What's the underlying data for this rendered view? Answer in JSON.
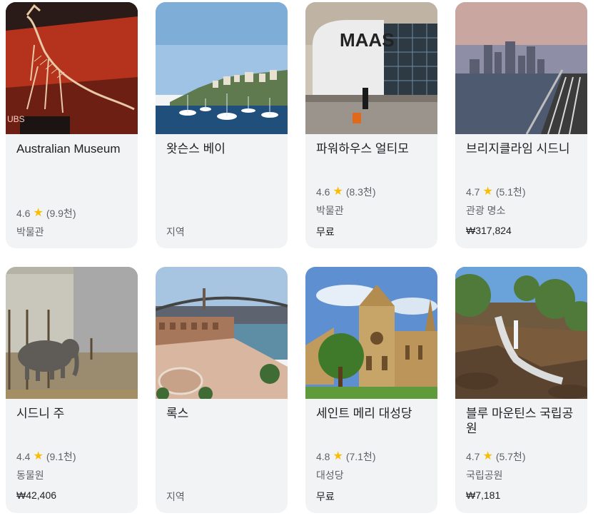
{
  "cards": [
    {
      "title": "Australian Museum",
      "rating": "4.6",
      "reviews": "(9.9천)",
      "category": "박물관",
      "price": ""
    },
    {
      "title": "왓슨스 베이",
      "rating": "",
      "reviews": "",
      "category": "지역",
      "price": ""
    },
    {
      "title": "파워하우스 얼티모",
      "rating": "4.6",
      "reviews": "(8.3천)",
      "category": "박물관",
      "price": "무료"
    },
    {
      "title": "브리지클라임 시드니",
      "rating": "4.7",
      "reviews": "(5.1천)",
      "category": "관광 명소",
      "price": "₩317,824"
    },
    {
      "title": "시드니 주",
      "rating": "4.4",
      "reviews": "(9.1천)",
      "category": "동물원",
      "price": "₩42,406"
    },
    {
      "title": "록스",
      "rating": "",
      "reviews": "",
      "category": "지역",
      "price": ""
    },
    {
      "title": "세인트 메리 대성당",
      "rating": "4.8",
      "reviews": "(7.1천)",
      "category": "대성당",
      "price": "무료"
    },
    {
      "title": "블루 마운틴스 국립공원",
      "rating": "4.7",
      "reviews": "(5.7천)",
      "category": "국립공원",
      "price": "₩7,181"
    }
  ],
  "photo_logo_text": "MAAS"
}
